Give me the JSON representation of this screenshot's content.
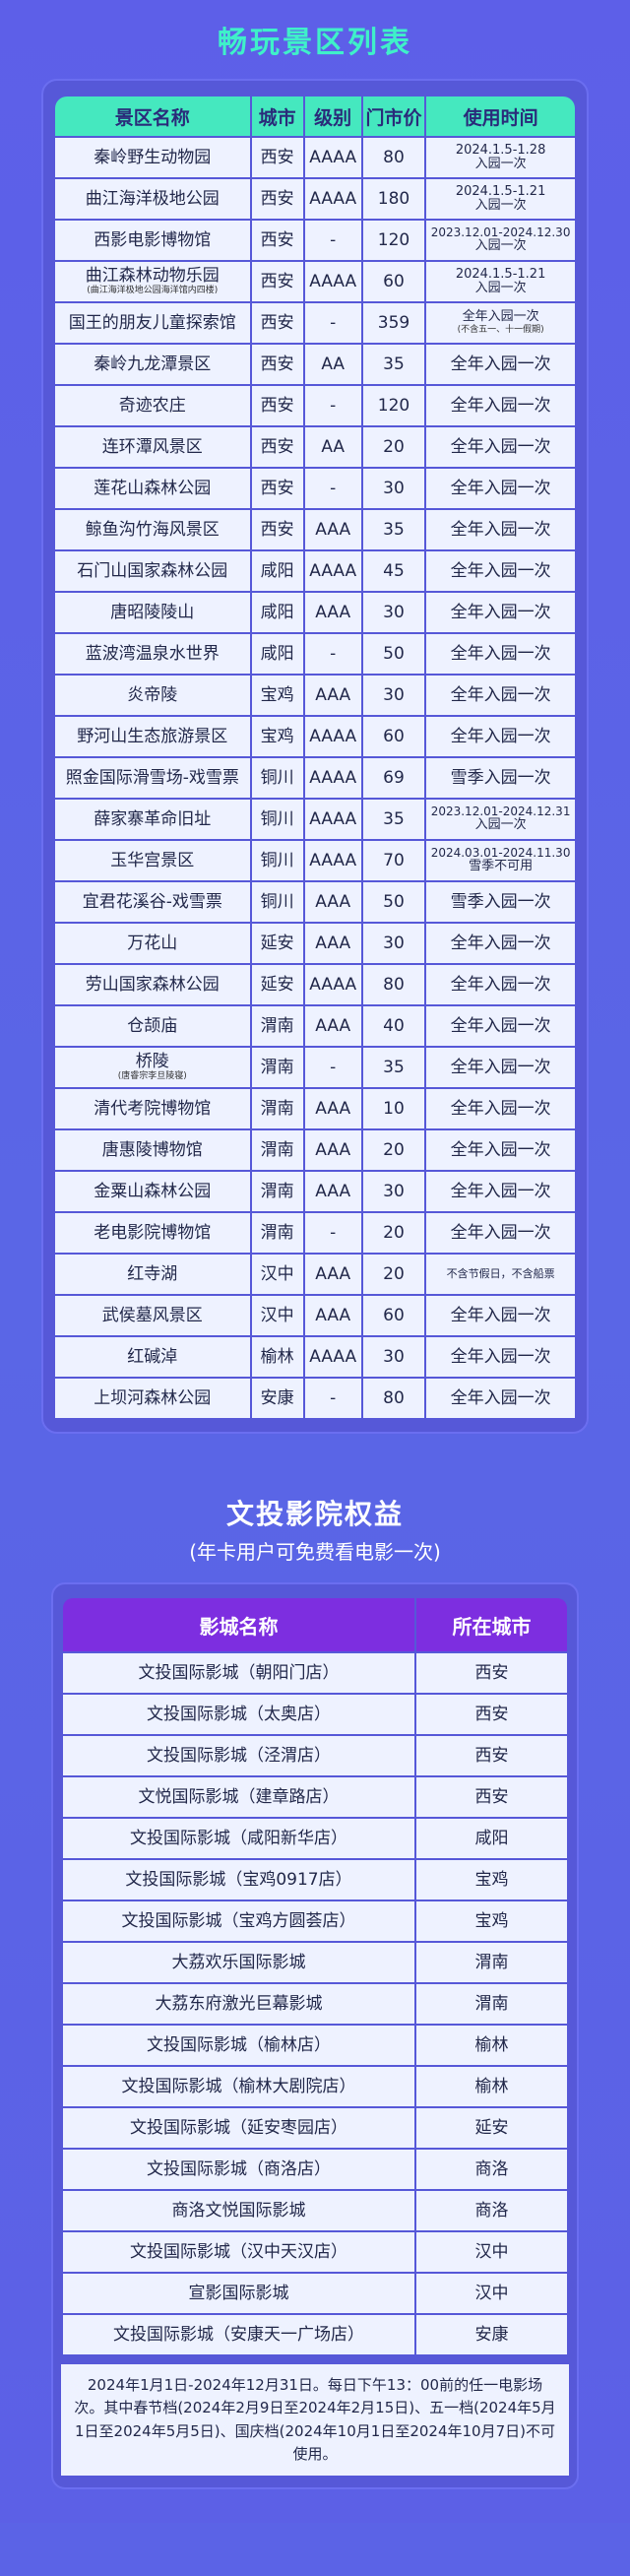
{
  "scenic": {
    "title": "畅玩景区列表",
    "headers": [
      "景区名称",
      "城市",
      "级别",
      "门市价",
      "使用时间"
    ],
    "rows": [
      {
        "name": "秦岭野生动物园",
        "city": "西安",
        "level": "AAAA",
        "price": "80",
        "time": "2024.1.5-1.28",
        "time2": "入园一次"
      },
      {
        "name": "曲江海洋极地公园",
        "city": "西安",
        "level": "AAAA",
        "price": "180",
        "time": "2024.1.5-1.21",
        "time2": "入园一次"
      },
      {
        "name": "西影电影博物馆",
        "city": "西安",
        "level": "-",
        "price": "120",
        "time": "2023.12.01-2024.12.30",
        "time2": "入园一次"
      },
      {
        "name": "曲江森林动物乐园",
        "name_sub": "(曲江海洋极地公园海洋馆内四楼)",
        "city": "西安",
        "level": "AAAA",
        "price": "60",
        "time": "2024.1.5-1.21",
        "time2": "入园一次"
      },
      {
        "name": "国王的朋友儿童探索馆",
        "city": "西安",
        "level": "-",
        "price": "359",
        "time": "全年入园一次",
        "time2": "(不含五一、十一假期)"
      },
      {
        "name": "秦岭九龙潭景区",
        "city": "西安",
        "level": "AA",
        "price": "35",
        "time": "全年入园一次"
      },
      {
        "name": "奇迹农庄",
        "city": "西安",
        "level": "-",
        "price": "120",
        "time": "全年入园一次"
      },
      {
        "name": "连环潭风景区",
        "city": "西安",
        "level": "AA",
        "price": "20",
        "time": "全年入园一次"
      },
      {
        "name": "莲花山森林公园",
        "city": "西安",
        "level": "-",
        "price": "30",
        "time": "全年入园一次"
      },
      {
        "name": "鲸鱼沟竹海风景区",
        "city": "西安",
        "level": "AAA",
        "price": "35",
        "time": "全年入园一次"
      },
      {
        "name": "石门山国家森林公园",
        "city": "咸阳",
        "level": "AAAA",
        "price": "45",
        "time": "全年入园一次"
      },
      {
        "name": "唐昭陵陵山",
        "city": "咸阳",
        "level": "AAA",
        "price": "30",
        "time": "全年入园一次"
      },
      {
        "name": "蓝波湾温泉水世界",
        "city": "咸阳",
        "level": "-",
        "price": "50",
        "time": "全年入园一次"
      },
      {
        "name": "炎帝陵",
        "city": "宝鸡",
        "level": "AAA",
        "price": "30",
        "time": "全年入园一次"
      },
      {
        "name": "野河山生态旅游景区",
        "city": "宝鸡",
        "level": "AAAA",
        "price": "60",
        "time": "全年入园一次"
      },
      {
        "name": "照金国际滑雪场-戏雪票",
        "city": "铜川",
        "level": "AAAA",
        "price": "69",
        "time": "雪季入园一次"
      },
      {
        "name": "薛家寨革命旧址",
        "city": "铜川",
        "level": "AAAA",
        "price": "35",
        "time": "2023.12.01-2024.12.31",
        "time2": "入园一次"
      },
      {
        "name": "玉华宫景区",
        "city": "铜川",
        "level": "AAAA",
        "price": "70",
        "time": "2024.03.01-2024.11.30",
        "time2": "雪季不可用"
      },
      {
        "name": "宜君花溪谷-戏雪票",
        "city": "铜川",
        "level": "AAA",
        "price": "50",
        "time": "雪季入园一次"
      },
      {
        "name": "万花山",
        "city": "延安",
        "level": "AAA",
        "price": "30",
        "time": "全年入园一次"
      },
      {
        "name": "劳山国家森林公园",
        "city": "延安",
        "level": "AAAA",
        "price": "80",
        "time": "全年入园一次"
      },
      {
        "name": "仓颉庙",
        "city": "渭南",
        "level": "AAA",
        "price": "40",
        "time": "全年入园一次"
      },
      {
        "name": "桥陵",
        "name_sub": "(唐睿宗李旦陵寝)",
        "city": "渭南",
        "level": "-",
        "price": "35",
        "time": "全年入园一次"
      },
      {
        "name": "清代考院博物馆",
        "city": "渭南",
        "level": "AAA",
        "price": "10",
        "time": "全年入园一次"
      },
      {
        "name": "唐惠陵博物馆",
        "city": "渭南",
        "level": "AAA",
        "price": "20",
        "time": "全年入园一次"
      },
      {
        "name": "金粟山森林公园",
        "city": "渭南",
        "level": "AAA",
        "price": "30",
        "time": "全年入园一次"
      },
      {
        "name": "老电影院博物馆",
        "city": "渭南",
        "level": "-",
        "price": "20",
        "time": "全年入园一次"
      },
      {
        "name": "红寺湖",
        "city": "汉中",
        "level": "AAA",
        "price": "20",
        "time": "不含节假日，不含船票"
      },
      {
        "name": "武侯墓风景区",
        "city": "汉中",
        "level": "AAA",
        "price": "60",
        "time": "全年入园一次"
      },
      {
        "name": "红碱淖",
        "city": "榆林",
        "level": "AAAA",
        "price": "30",
        "time": "全年入园一次"
      },
      {
        "name": "上坝河森林公园",
        "city": "安康",
        "level": "-",
        "price": "80",
        "time": "全年入园一次"
      }
    ]
  },
  "cinema": {
    "title": "文投影院权益",
    "subtitle": "(年卡用户可免费看电影一次)",
    "headers": [
      "影城名称",
      "所在城市"
    ],
    "rows": [
      {
        "name": "文投国际影城（朝阳门店）",
        "city": "西安"
      },
      {
        "name": "文投国际影城（太奥店）",
        "city": "西安"
      },
      {
        "name": "文投国际影城（泾渭店）",
        "city": "西安"
      },
      {
        "name": "文悦国际影城（建章路店）",
        "city": "西安"
      },
      {
        "name": "文投国际影城（咸阳新华店）",
        "city": "咸阳"
      },
      {
        "name": "文投国际影城（宝鸡0917店）",
        "city": "宝鸡"
      },
      {
        "name": "文投国际影城（宝鸡方圆荟店）",
        "city": "宝鸡"
      },
      {
        "name": "大荔欢乐国际影城",
        "city": "渭南"
      },
      {
        "name": "大荔东府激光巨幕影城",
        "city": "渭南"
      },
      {
        "name": "文投国际影城（榆林店）",
        "city": "榆林"
      },
      {
        "name": "文投国际影城（榆林大剧院店）",
        "city": "榆林"
      },
      {
        "name": "文投国际影城（延安枣园店）",
        "city": "延安"
      },
      {
        "name": "文投国际影城（商洛店）",
        "city": "商洛"
      },
      {
        "name": "商洛文悦国际影城",
        "city": "商洛"
      },
      {
        "name": "文投国际影城（汉中天汉店）",
        "city": "汉中"
      },
      {
        "name": "宣影国际影城",
        "city": "汉中"
      },
      {
        "name": "文投国际影城（安康天一广场店）",
        "city": "安康"
      }
    ],
    "note": "2024年1月1日-2024年12月31日。每日下午13：00前的任一电影场次。其中春节档(2024年2月9日至2024年2月15日)、五一档(2024年5月1日至2024年5月5日)、国庆档(2024年10月1日至2024年10月7日)不可使用。"
  }
}
